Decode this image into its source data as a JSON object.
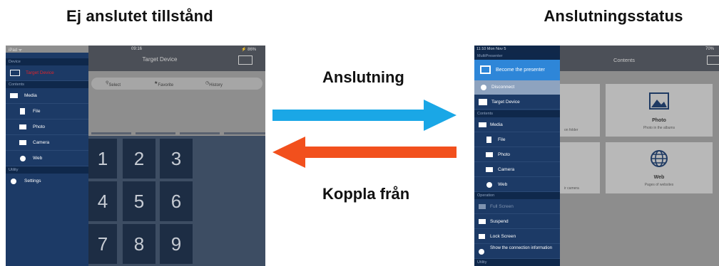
{
  "headings": {
    "left": "Ej anslutet tillstånd",
    "right": "Anslutningsstatus"
  },
  "arrows": {
    "connect_label": "Anslutning",
    "disconnect_label": "Koppla från",
    "connect_color": "#1aa7e6",
    "disconnect_color": "#f2501d"
  },
  "left_device": {
    "status_left": "iPad ᯤ",
    "status_time": "09:16",
    "status_right": "⚡ 86%",
    "nav_title": "Target Device",
    "segments": [
      "Select",
      "Favorite",
      "History"
    ],
    "keypad": [
      "1",
      "2",
      "3",
      "4",
      "5",
      "6",
      "7",
      "8",
      "9"
    ],
    "menu": {
      "section_device": "Device",
      "target_device": "Target Device",
      "target_device_color": "#e0242a",
      "section_contents": "Contents",
      "media": "Media",
      "file": "File",
      "photo": "Photo",
      "camera": "Camera",
      "web": "Web",
      "section_utility": "Utility",
      "settings": "Settings"
    }
  },
  "right_device": {
    "status": "11:10  Mon Nov 5",
    "battery": "70%",
    "nav_title": "Contents",
    "menu": {
      "section_multipresenter": "MultiPresenter",
      "become_presenter": "Become the presenter",
      "disconnect": "Disconnect",
      "target_device": "Target Device",
      "section_contents": "Contents",
      "media": "Media",
      "file": "File",
      "photo": "Photo",
      "camera": "Camera",
      "web": "Web",
      "section_operation": "Operation",
      "full_screen": "Full Screen",
      "suspend": "Suspend",
      "lock_screen": "Lock Screen",
      "show_connection": "Show the connection information",
      "section_utility": "Utility"
    },
    "cards": {
      "photo_title": "Photo",
      "photo_sub": "Photo in the albums",
      "web_title": "Web",
      "web_sub": "Pages of websites",
      "partial_folder": "on folder",
      "partial_camera": "ir camera"
    }
  }
}
